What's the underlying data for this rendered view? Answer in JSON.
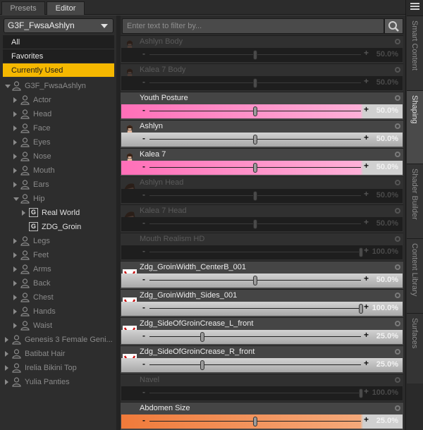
{
  "tabs": {
    "presets": "Presets",
    "editor": "Editor"
  },
  "figure": {
    "selected": "G3F_FwsaAshlyn"
  },
  "categories": [
    "All",
    "Favorites",
    "Currently Used"
  ],
  "tree": [
    {
      "label": "G3F_FwsaAshlyn",
      "depth": 0,
      "arrow": "down",
      "icon": "figure",
      "lit": false
    },
    {
      "label": "Actor",
      "depth": 1,
      "arrow": "right",
      "icon": "figure",
      "lit": false
    },
    {
      "label": "Head",
      "depth": 1,
      "arrow": "right",
      "icon": "figure",
      "lit": false
    },
    {
      "label": "Face",
      "depth": 1,
      "arrow": "right",
      "icon": "figure",
      "lit": false
    },
    {
      "label": "Eyes",
      "depth": 1,
      "arrow": "right",
      "icon": "figure",
      "lit": false
    },
    {
      "label": "Nose",
      "depth": 1,
      "arrow": "right",
      "icon": "figure",
      "lit": false
    },
    {
      "label": "Mouth",
      "depth": 1,
      "arrow": "right",
      "icon": "figure",
      "lit": false
    },
    {
      "label": "Ears",
      "depth": 1,
      "arrow": "right",
      "icon": "figure",
      "lit": false
    },
    {
      "label": "Hip",
      "depth": 1,
      "arrow": "down",
      "icon": "figure",
      "lit": false
    },
    {
      "label": "Real World",
      "depth": 2,
      "arrow": "right",
      "icon": "group",
      "lit": true
    },
    {
      "label": "ZDG_Groin",
      "depth": 2,
      "arrow": "none",
      "icon": "group",
      "lit": true
    },
    {
      "label": "Legs",
      "depth": 1,
      "arrow": "right",
      "icon": "figure",
      "lit": false
    },
    {
      "label": "Feet",
      "depth": 1,
      "arrow": "right",
      "icon": "figure",
      "lit": false
    },
    {
      "label": "Arms",
      "depth": 1,
      "arrow": "right",
      "icon": "figure",
      "lit": false
    },
    {
      "label": "Back",
      "depth": 1,
      "arrow": "right",
      "icon": "figure",
      "lit": false
    },
    {
      "label": "Chest",
      "depth": 1,
      "arrow": "right",
      "icon": "figure",
      "lit": false
    },
    {
      "label": "Hands",
      "depth": 1,
      "arrow": "right",
      "icon": "figure",
      "lit": false
    },
    {
      "label": "Waist",
      "depth": 1,
      "arrow": "right",
      "icon": "figure",
      "lit": false
    },
    {
      "label": "Genesis 3 Female Geni...",
      "depth": 0,
      "arrow": "right",
      "icon": "figure",
      "lit": false
    },
    {
      "label": "Batibat Hair",
      "depth": 0,
      "arrow": "right",
      "icon": "figure",
      "lit": false
    },
    {
      "label": "Irelia Bikini Top",
      "depth": 0,
      "arrow": "right",
      "icon": "figure",
      "lit": false
    },
    {
      "label": "Yulia Panties",
      "depth": 0,
      "arrow": "right",
      "icon": "figure",
      "lit": false
    }
  ],
  "filter": {
    "placeholder": "Enter text to filter by..."
  },
  "sliders": [
    {
      "name": "Ashlyn Body",
      "value": "50.0%",
      "fraction": 0.5,
      "enabled": false,
      "thumb": "body",
      "fill": "none"
    },
    {
      "name": "Kalea 7 Body",
      "value": "50.0%",
      "fraction": 0.5,
      "enabled": false,
      "thumb": "body",
      "fill": "none"
    },
    {
      "name": "Youth Posture",
      "value": "50.0%",
      "fraction": 0.5,
      "enabled": true,
      "thumb": "none",
      "fill": "pink"
    },
    {
      "name": "Ashlyn",
      "value": "50.0%",
      "fraction": 0.5,
      "enabled": true,
      "thumb": "body",
      "fill": "gray"
    },
    {
      "name": "Kalea 7",
      "value": "50.0%",
      "fraction": 0.5,
      "enabled": true,
      "thumb": "body",
      "fill": "pink"
    },
    {
      "name": "Ashlyn Head",
      "value": "50.0%",
      "fraction": 0.5,
      "enabled": false,
      "thumb": "head",
      "fill": "none"
    },
    {
      "name": "Kalea 7 Head",
      "value": "50.0%",
      "fraction": 0.5,
      "enabled": false,
      "thumb": "head",
      "fill": "none"
    },
    {
      "name": "Mouth Realism HD",
      "value": "100.0%",
      "fraction": 1.0,
      "enabled": false,
      "thumb": "none",
      "fill": "none"
    },
    {
      "name": "Zdg_GroinWidth_CenterB_001",
      "value": "50.0%",
      "fraction": 0.5,
      "enabled": true,
      "thumb": "zdg",
      "fill": "gray"
    },
    {
      "name": "Zdg_GroinWidth_Sides_001",
      "value": "100.0%",
      "fraction": 1.0,
      "enabled": true,
      "thumb": "zdg",
      "fill": "gray"
    },
    {
      "name": "Zdg_SideOfGroinCrease_L_front",
      "value": "25.0%",
      "fraction": 0.25,
      "enabled": true,
      "thumb": "zdg",
      "fill": "gray"
    },
    {
      "name": "Zdg_SideOfGroinCrease_R_front",
      "value": "25.0%",
      "fraction": 0.25,
      "enabled": true,
      "thumb": "zdg",
      "fill": "gray"
    },
    {
      "name": "Navel",
      "value": "100.0%",
      "fraction": 1.0,
      "enabled": false,
      "thumb": "none",
      "fill": "none"
    },
    {
      "name": "Abdomen Size",
      "value": "25.0%",
      "fraction": 0.5,
      "enabled": true,
      "thumb": "none",
      "fill": "orange"
    }
  ],
  "side_tabs": [
    {
      "label": "Smart Content",
      "active": false
    },
    {
      "label": "Shaping",
      "active": true
    },
    {
      "label": "Shader Builder",
      "active": false
    },
    {
      "label": "Content Library",
      "active": false
    },
    {
      "label": "Surfaces",
      "active": false
    }
  ],
  "colors": {
    "accent": "#f5b800",
    "pink": "#ff8fc8",
    "orange": "#f08040"
  }
}
